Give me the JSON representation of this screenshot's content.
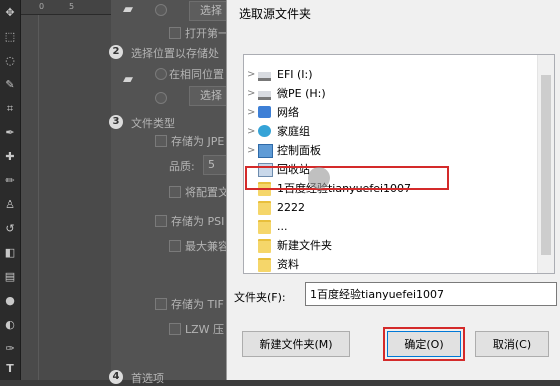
{
  "ps": {
    "ruler_ticks": [
      "0",
      "5"
    ],
    "btn_select_1": "选择",
    "open_first": "打开第一",
    "step2_title": "选择位置以存储处",
    "same_location": "在相同位置",
    "btn_select_2": "选择",
    "step3_title": "文件类型",
    "save_as_jpeg": "存储为 JPE",
    "quality_label": "品质:",
    "quality_value": "5",
    "convert_profile": "将配置文",
    "save_as_psd": "存储为 PSI",
    "max_compat": "最大兼容",
    "save_as_tiff": "存储为 TIF",
    "lzw": "LZW 压",
    "step_nums": [
      "2",
      "3",
      "4"
    ],
    "preferences": "首选项"
  },
  "dialog": {
    "title": "选取源文件夹",
    "tree": [
      {
        "label": "EFI (I:)",
        "icon": "drive-icon",
        "expandable": true
      },
      {
        "label": "微PE (H:)",
        "icon": "drive-icon",
        "expandable": true
      },
      {
        "label": "网络",
        "icon": "network-icon",
        "expandable": true
      },
      {
        "label": "家庭组",
        "icon": "homegroup-icon",
        "expandable": true
      },
      {
        "label": "控制面板",
        "icon": "control-panel-icon",
        "expandable": true
      },
      {
        "label": "回收站",
        "icon": "recycle-bin-icon",
        "expandable": false
      },
      {
        "label": "1百度经验tianyuefei1007",
        "icon": "folder-icon",
        "expandable": false
      },
      {
        "label": "2222",
        "icon": "folder-icon",
        "expandable": false
      },
      {
        "label": "...",
        "icon": "folder-icon",
        "expandable": false
      },
      {
        "label": "新建文件夹",
        "icon": "folder-icon",
        "expandable": false
      },
      {
        "label": "资料",
        "icon": "folder-icon",
        "expandable": false
      }
    ],
    "folder_label": "文件夹(F):",
    "folder_value": "1百度经验tianyuefei1007",
    "new_folder_btn": "新建文件夹(M)",
    "ok_btn": "确定(O)",
    "cancel_btn": "取消(C)"
  }
}
